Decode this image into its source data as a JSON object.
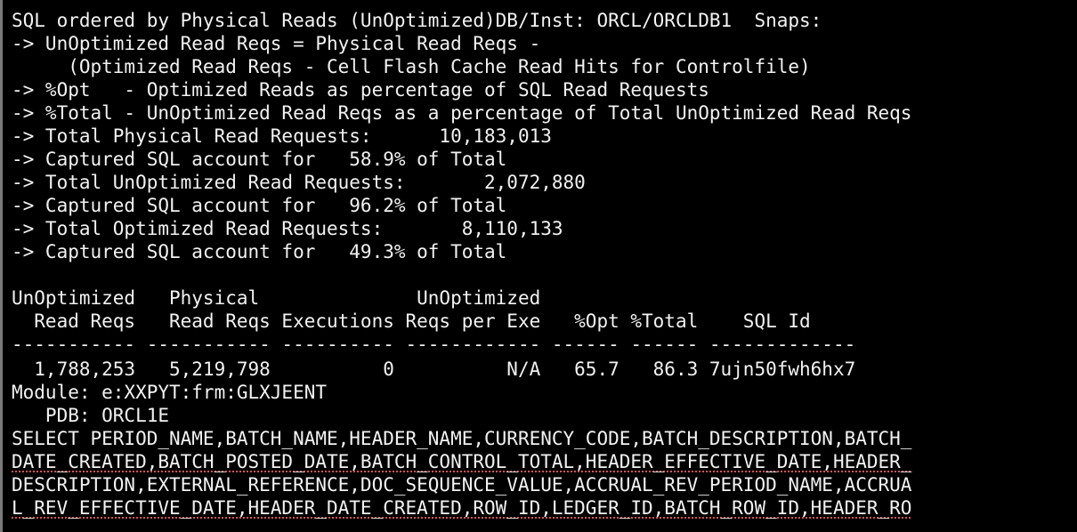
{
  "terminal": {
    "lines": [
      "SQL ordered by Physical Reads (UnOptimized)DB/Inst: ORCL/ORCLDB1  Snaps:",
      "-> UnOptimized Read Reqs = Physical Read Reqs -",
      "     (Optimized Read Reqs - Cell Flash Cache Read Hits for Controlfile)",
      "-> %Opt   - Optimized Reads as percentage of SQL Read Requests",
      "-> %Total - UnOptimized Read Reqs as a percentage of Total UnOptimized Read Reqs",
      "-> Total Physical Read Requests:      10,183,013",
      "-> Captured SQL account for   58.9% of Total",
      "-> Total UnOptimized Read Requests:       2,072,880",
      "-> Captured SQL account for   96.2% of Total",
      "-> Total Optimized Read Requests:       8,110,133",
      "-> Captured SQL account for   49.3% of Total",
      "",
      "UnOptimized   Physical              UnOptimized",
      "  Read Reqs   Read Reqs Executions Reqs per Exe   %Opt %Total    SQL Id",
      "----------- ----------- ---------- ------------ ------ ------ -------------",
      "  1,788,253   5,219,798          0          N/A   65.7   86.3 7ujn50fwh6hx7",
      "Module: e:XXPYT:frm:GLXJEENT",
      "   PDB: ORCL1E",
      "SELECT PERIOD_NAME,BATCH_NAME,HEADER_NAME,CURRENCY_CODE,BATCH_DESCRIPTION,BATCH_",
      "DATE_CREATED,BATCH_POSTED_DATE,BATCH_CONTROL_TOTAL,HEADER_EFFECTIVE_DATE,HEADER_",
      "DESCRIPTION,EXTERNAL_REFERENCE,DOC_SEQUENCE_VALUE,ACCRUAL_REV_PERIOD_NAME,ACCRUA",
      "L_REV_EFFECTIVE_DATE,HEADER_DATE_CREATED,ROW_ID,LEDGER_ID,BATCH_ROW_ID,HEADER_RO"
    ]
  }
}
